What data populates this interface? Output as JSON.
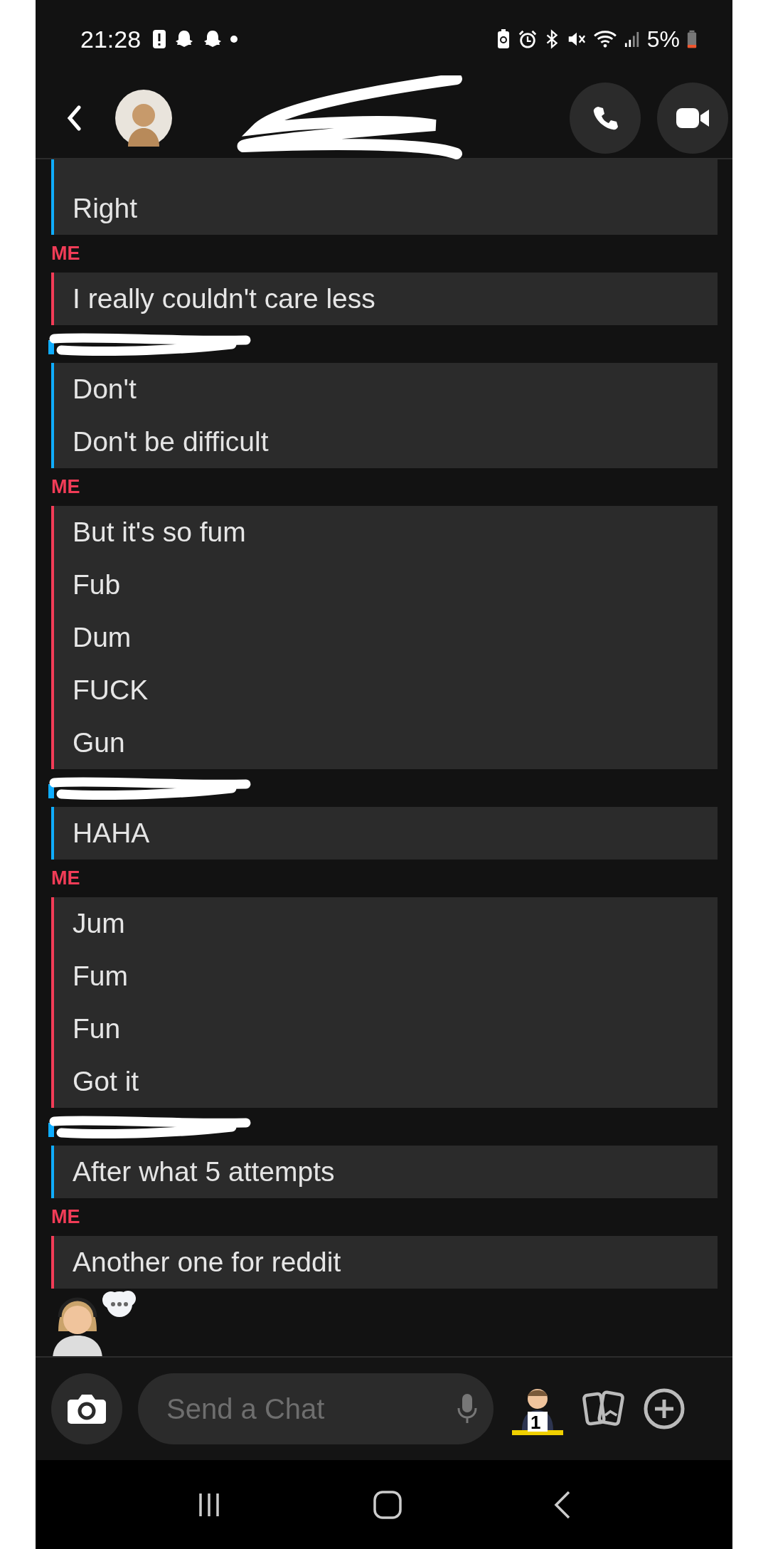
{
  "status_bar": {
    "time": "21:28",
    "battery": "5%"
  },
  "header": {
    "title_redacted": true
  },
  "groups": [
    {
      "kind": "friend",
      "color": "#0fadff",
      "messages": [
        "Right"
      ]
    },
    {
      "kind": "me",
      "label": "ME",
      "color": "#f23c57",
      "messages": [
        "I really couldn't care less"
      ]
    },
    {
      "kind": "friend",
      "color": "#0fadff",
      "messages": [
        "Don't",
        "Don't be difficult"
      ]
    },
    {
      "kind": "me",
      "label": "ME",
      "color": "#f23c57",
      "messages": [
        "But it's so fum",
        "Fub",
        "Dum",
        "FUCK",
        "Gun"
      ]
    },
    {
      "kind": "friend",
      "color": "#0fadff",
      "messages": [
        "HAHA"
      ]
    },
    {
      "kind": "me",
      "label": "ME",
      "color": "#f23c57",
      "messages": [
        "Jum",
        "Fum",
        "Fun",
        "Got it"
      ]
    },
    {
      "kind": "friend",
      "color": "#0fadff",
      "messages": [
        "After what 5 attempts"
      ]
    },
    {
      "kind": "me",
      "label": "ME",
      "color": "#f23c57",
      "messages": [
        "Another one for reddit"
      ]
    }
  ],
  "typing": {
    "thinking": true
  },
  "composer": {
    "placeholder": "Send a Chat",
    "sticker_badge": "1"
  }
}
